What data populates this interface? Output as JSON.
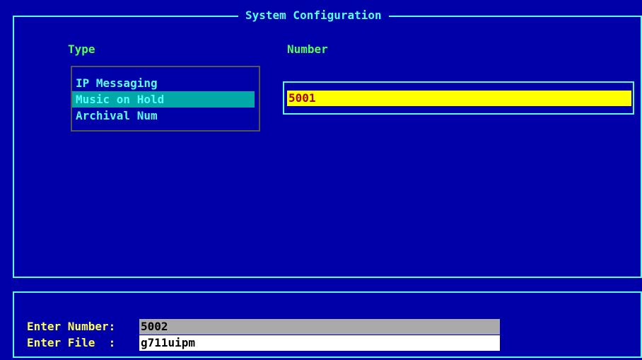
{
  "window": {
    "title": "System Configuration"
  },
  "headers": {
    "type": "Type",
    "number": "Number"
  },
  "type_list": {
    "items": [
      "IP Messaging",
      "Music on Hold",
      "Archival Num"
    ],
    "selected": "Music on Hold"
  },
  "number": {
    "value": "5001"
  },
  "prompts": {
    "enter_number_label": "Enter Number:",
    "enter_number_value": "5002",
    "enter_file_label": "Enter File  :",
    "enter_file_value": "g711uipm"
  },
  "colors": {
    "background": "#0000a8",
    "border": "#55ffff",
    "header_text": "#55ff55",
    "prompt_text": "#ffff55",
    "selection": "#00a8a8",
    "number_field": "#ffff00",
    "number_text": "#a80000"
  }
}
